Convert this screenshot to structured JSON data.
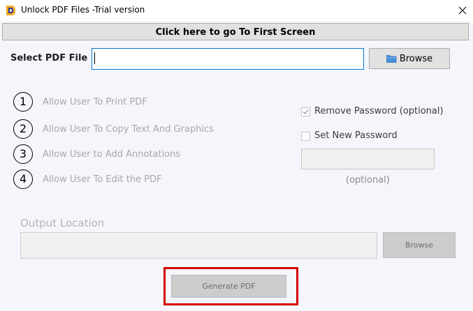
{
  "window": {
    "title": "Unlock PDF Files -Trial version",
    "icon": "app-logo-icon",
    "close_icon": "close-icon"
  },
  "first_screen": {
    "label": "Click here to go To First Screen"
  },
  "file_select": {
    "label": "Select PDF File",
    "value": "",
    "browse_label": "Browse",
    "browse_icon": "folder-icon"
  },
  "options": [
    {
      "number": "1",
      "label": "Allow User To Print PDF"
    },
    {
      "number": "2",
      "label": "Allow User To Copy Text And Graphics"
    },
    {
      "number": "3",
      "label": "Allow User to Add Annotations"
    },
    {
      "number": "4",
      "label": "Allow User To Edit the PDF"
    }
  ],
  "password": {
    "remove_label": "Remove Password (optional)",
    "remove_checked": true,
    "set_label": "Set New Password",
    "set_checked": false,
    "new_value": "",
    "optional_label": "(optional)"
  },
  "output": {
    "label": "Output Location",
    "value": "",
    "browse_label": "Browse"
  },
  "generate": {
    "label": "Generate PDF"
  },
  "colors": {
    "highlight": "#d40000",
    "client_bg": "#f4f6fb",
    "disabled_text": "#a8a8a8"
  }
}
